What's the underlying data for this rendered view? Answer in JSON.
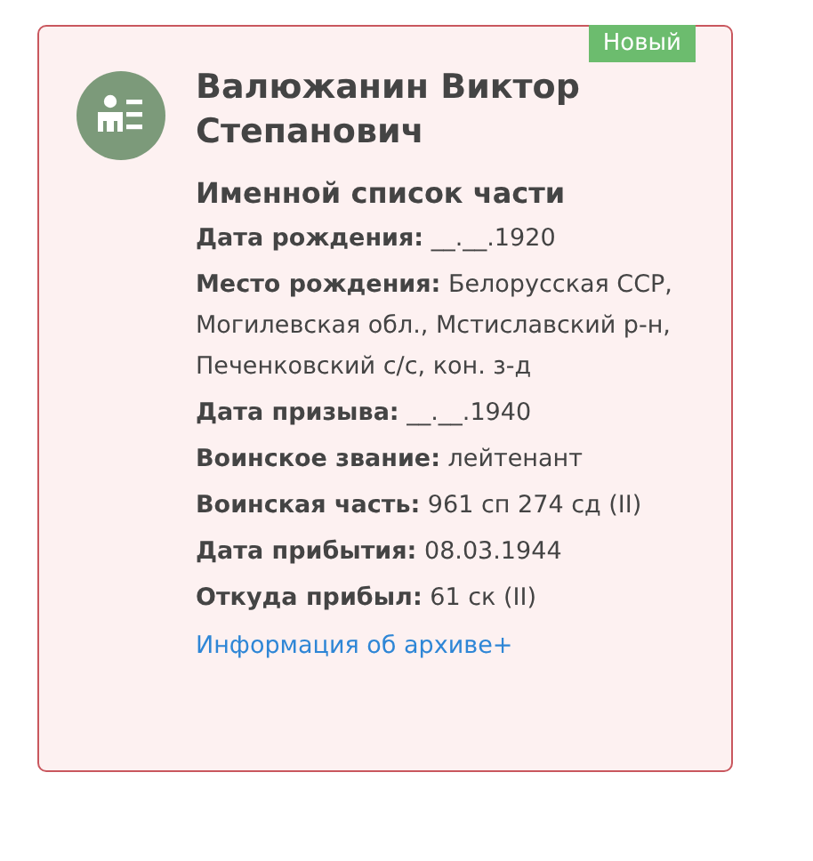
{
  "card": {
    "badge": "Новый",
    "name": "Валюжанин Виктор Степанович",
    "source": "Именной список части",
    "fields": [
      {
        "text": "**Дата рождения:** __.__.1920"
      },
      {
        "text": "**Место рождения:** Белорусская ССР, Могилевская обл., Мстиславский р-н, Печенковский с/с, кон. з-д"
      },
      {
        "text": "**Дата призыва:** __.__.1940"
      },
      {
        "text": "**Воинское звание:** лейтенант"
      },
      {
        "text": "**Воинская часть:** 961 сп 274 сд (II)"
      },
      {
        "text": "**Дата прибытия:** 08.03.1944"
      },
      {
        "text": "**Откуда прибыл:** 61 ск (II)"
      }
    ],
    "link": "Информация об архиве+"
  }
}
